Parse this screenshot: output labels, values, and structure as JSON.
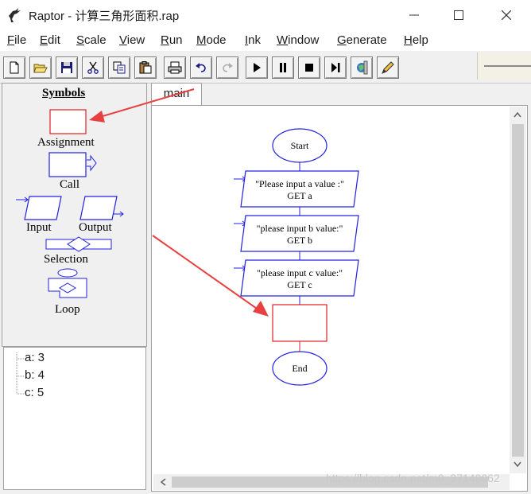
{
  "window": {
    "title": "Raptor - 计算三角形面积.rap"
  },
  "menu": {
    "items": [
      {
        "id": "file",
        "underline": "F",
        "rest": "ile"
      },
      {
        "id": "edit",
        "underline": "E",
        "rest": "dit"
      },
      {
        "id": "scale",
        "underline": "S",
        "rest": "cale"
      },
      {
        "id": "view",
        "underline": "V",
        "rest": "iew"
      },
      {
        "id": "run",
        "underline": "R",
        "rest": "un"
      },
      {
        "id": "mode",
        "underline": "M",
        "rest": "ode"
      },
      {
        "id": "ink",
        "underline": "I",
        "rest": "nk"
      },
      {
        "id": "window",
        "underline": "W",
        "rest": "indow"
      },
      {
        "id": "generate",
        "underline": "G",
        "rest": "enerate"
      },
      {
        "id": "help",
        "underline": "H",
        "rest": "elp"
      }
    ]
  },
  "toolbar": {
    "buttons": [
      "new-file-icon",
      "open-folder-icon",
      "save-icon",
      "cut-icon",
      "copy-icon",
      "paste-icon",
      "print-icon",
      "undo-icon",
      "redo-icon",
      "play-icon",
      "pause-icon",
      "stop-icon",
      "step-icon",
      "test-server-icon",
      "ink-pen-icon"
    ]
  },
  "symbols": {
    "heading": "Symbols",
    "assignment": "Assignment",
    "call": "Call",
    "input": "Input",
    "output": "Output",
    "selection": "Selection",
    "loop": "Loop"
  },
  "variables": [
    {
      "text": "a: 3"
    },
    {
      "text": "b: 4"
    },
    {
      "text": "c: 5"
    }
  ],
  "tabs": {
    "main": "main"
  },
  "flowchart": {
    "start": "Start",
    "input1_prompt": "\"Please input a value :\"",
    "input1_get": "GET a",
    "input2_prompt": "\"please input b value:\"",
    "input2_get": "GET b",
    "input3_prompt": "\"please input c value:\"",
    "input3_get": "GET c",
    "end": "End"
  },
  "watermark": "https://blog.csdn.net/m0_37149062",
  "colors": {
    "flow_blue": "#2020e0",
    "assignment_red": "#e02020",
    "arrow_red": "#e84040"
  }
}
